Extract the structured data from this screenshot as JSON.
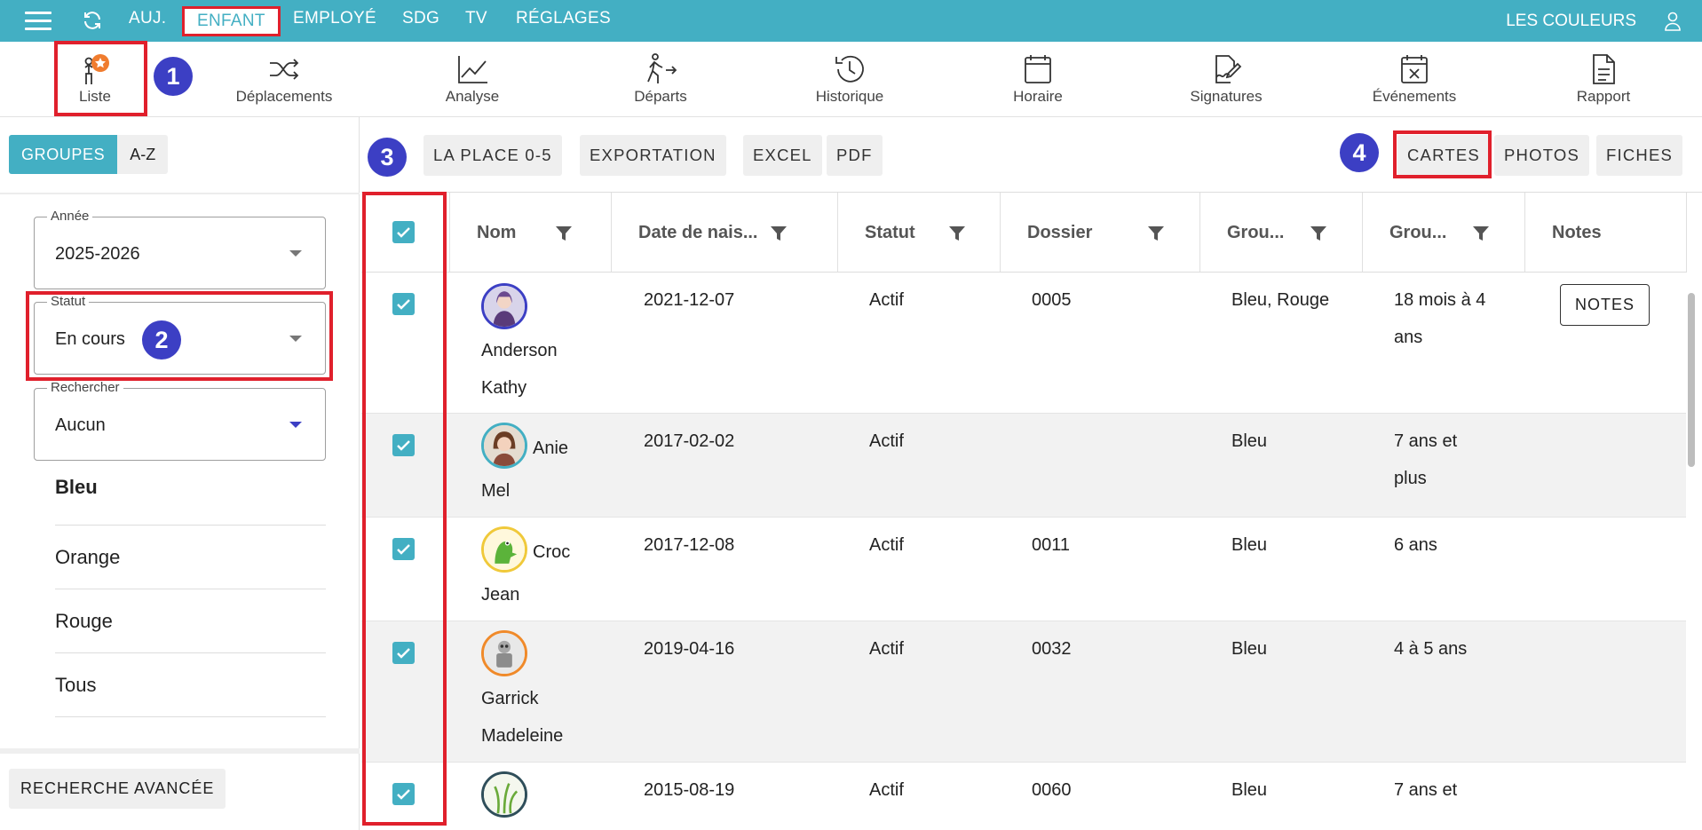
{
  "topnav": {
    "items": [
      {
        "label": "AUJ."
      },
      {
        "label": "ENFANT"
      },
      {
        "label": "EMPLOYÉ"
      },
      {
        "label": "SDG"
      },
      {
        "label": "TV"
      },
      {
        "label": "RÉGLAGES"
      }
    ],
    "org": "LES COULEURS",
    "accent": "#43afc3"
  },
  "subnav": {
    "items": [
      {
        "label": "Liste",
        "icon": "person-star-icon"
      },
      {
        "label": "Déplacements",
        "icon": "shuffle-icon"
      },
      {
        "label": "Analyse",
        "icon": "line-chart-icon"
      },
      {
        "label": "Départs",
        "icon": "walk-out-icon"
      },
      {
        "label": "Historique",
        "icon": "history-icon"
      },
      {
        "label": "Horaire",
        "icon": "calendar-icon"
      },
      {
        "label": "Signatures",
        "icon": "signature-icon"
      },
      {
        "label": "Événements",
        "icon": "calendar-x-icon"
      },
      {
        "label": "Rapport",
        "icon": "document-icon"
      }
    ]
  },
  "badges": [
    "1",
    "2",
    "3",
    "4"
  ],
  "left": {
    "segments": [
      "GROUPES",
      "A-Z"
    ],
    "annee": {
      "label": "Année",
      "value": "2025-2026"
    },
    "statut": {
      "label": "Statut",
      "value": "En cours"
    },
    "rechercher": {
      "label": "Rechercher",
      "value": "Aucun"
    },
    "groups": [
      "Bleu",
      "Orange",
      "Rouge",
      "Tous"
    ],
    "advanced": "RECHERCHE AVANCÉE"
  },
  "actions": [
    "LA PLACE 0-5",
    "EXPORTATION",
    "EXCEL",
    "PDF",
    "CARTES",
    "PHOTOS",
    "FICHES"
  ],
  "table": {
    "headers": [
      "Nom",
      "Date de nais...",
      "Statut",
      "Dossier",
      "Grou...",
      "Grou...",
      "Notes"
    ],
    "rows": [
      {
        "first": "Anderson",
        "last": "Kathy",
        "dob": "2021-12-07",
        "statut": "Actif",
        "dossier": "0005",
        "groupe": "Bleu, Rouge",
        "age1": "18 mois à 4",
        "age2": "ans",
        "notes": "NOTES"
      },
      {
        "first": "Anie",
        "last": "Mel",
        "dob": "2017-02-02",
        "statut": "Actif",
        "dossier": "",
        "groupe": "Bleu",
        "age1": "7 ans et",
        "age2": "plus",
        "notes": ""
      },
      {
        "first": "Croc",
        "last": "Jean",
        "dob": "2017-12-08",
        "statut": "Actif",
        "dossier": "0011",
        "groupe": "Bleu",
        "age1": "6 ans",
        "age2": "",
        "notes": ""
      },
      {
        "first": "Garrick",
        "last": "Madeleine",
        "dob": "2019-04-16",
        "statut": "Actif",
        "dossier": "0032",
        "groupe": "Bleu",
        "age1": "4 à 5 ans",
        "age2": "",
        "notes": ""
      },
      {
        "first": "",
        "last": "",
        "dob": "2015-08-19",
        "statut": "Actif",
        "dossier": "0060",
        "groupe": "Bleu",
        "age1": "7 ans et",
        "age2": "",
        "notes": ""
      }
    ]
  }
}
